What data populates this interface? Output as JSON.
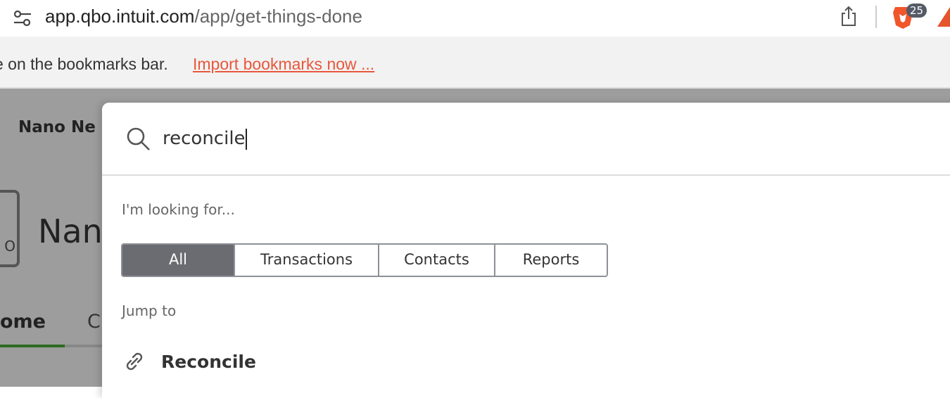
{
  "browser": {
    "url_host": "app.qbo.intuit.com",
    "url_path": "/app/get-things-done",
    "extension_badge": "25",
    "brand_color": "#e8573b"
  },
  "bookmarks_bar": {
    "message": "e on the bookmarks bar.",
    "import_link": "Import bookmarks now ..."
  },
  "background": {
    "company_short": "Nano Ne",
    "company_large": "Nan",
    "logo_text": "O",
    "tab_home": "ome",
    "tab_next": "C",
    "active_tab_color": "#2d6a1f"
  },
  "search_modal": {
    "query": "reconcile",
    "looking_for_label": "I'm looking for...",
    "filters": [
      {
        "label": "All",
        "selected": true
      },
      {
        "label": "Transactions",
        "selected": false
      },
      {
        "label": "Contacts",
        "selected": false
      },
      {
        "label": "Reports",
        "selected": false
      }
    ],
    "jump_to_label": "Jump to",
    "results": [
      {
        "label": "Reconcile",
        "icon": "link-icon"
      }
    ]
  }
}
